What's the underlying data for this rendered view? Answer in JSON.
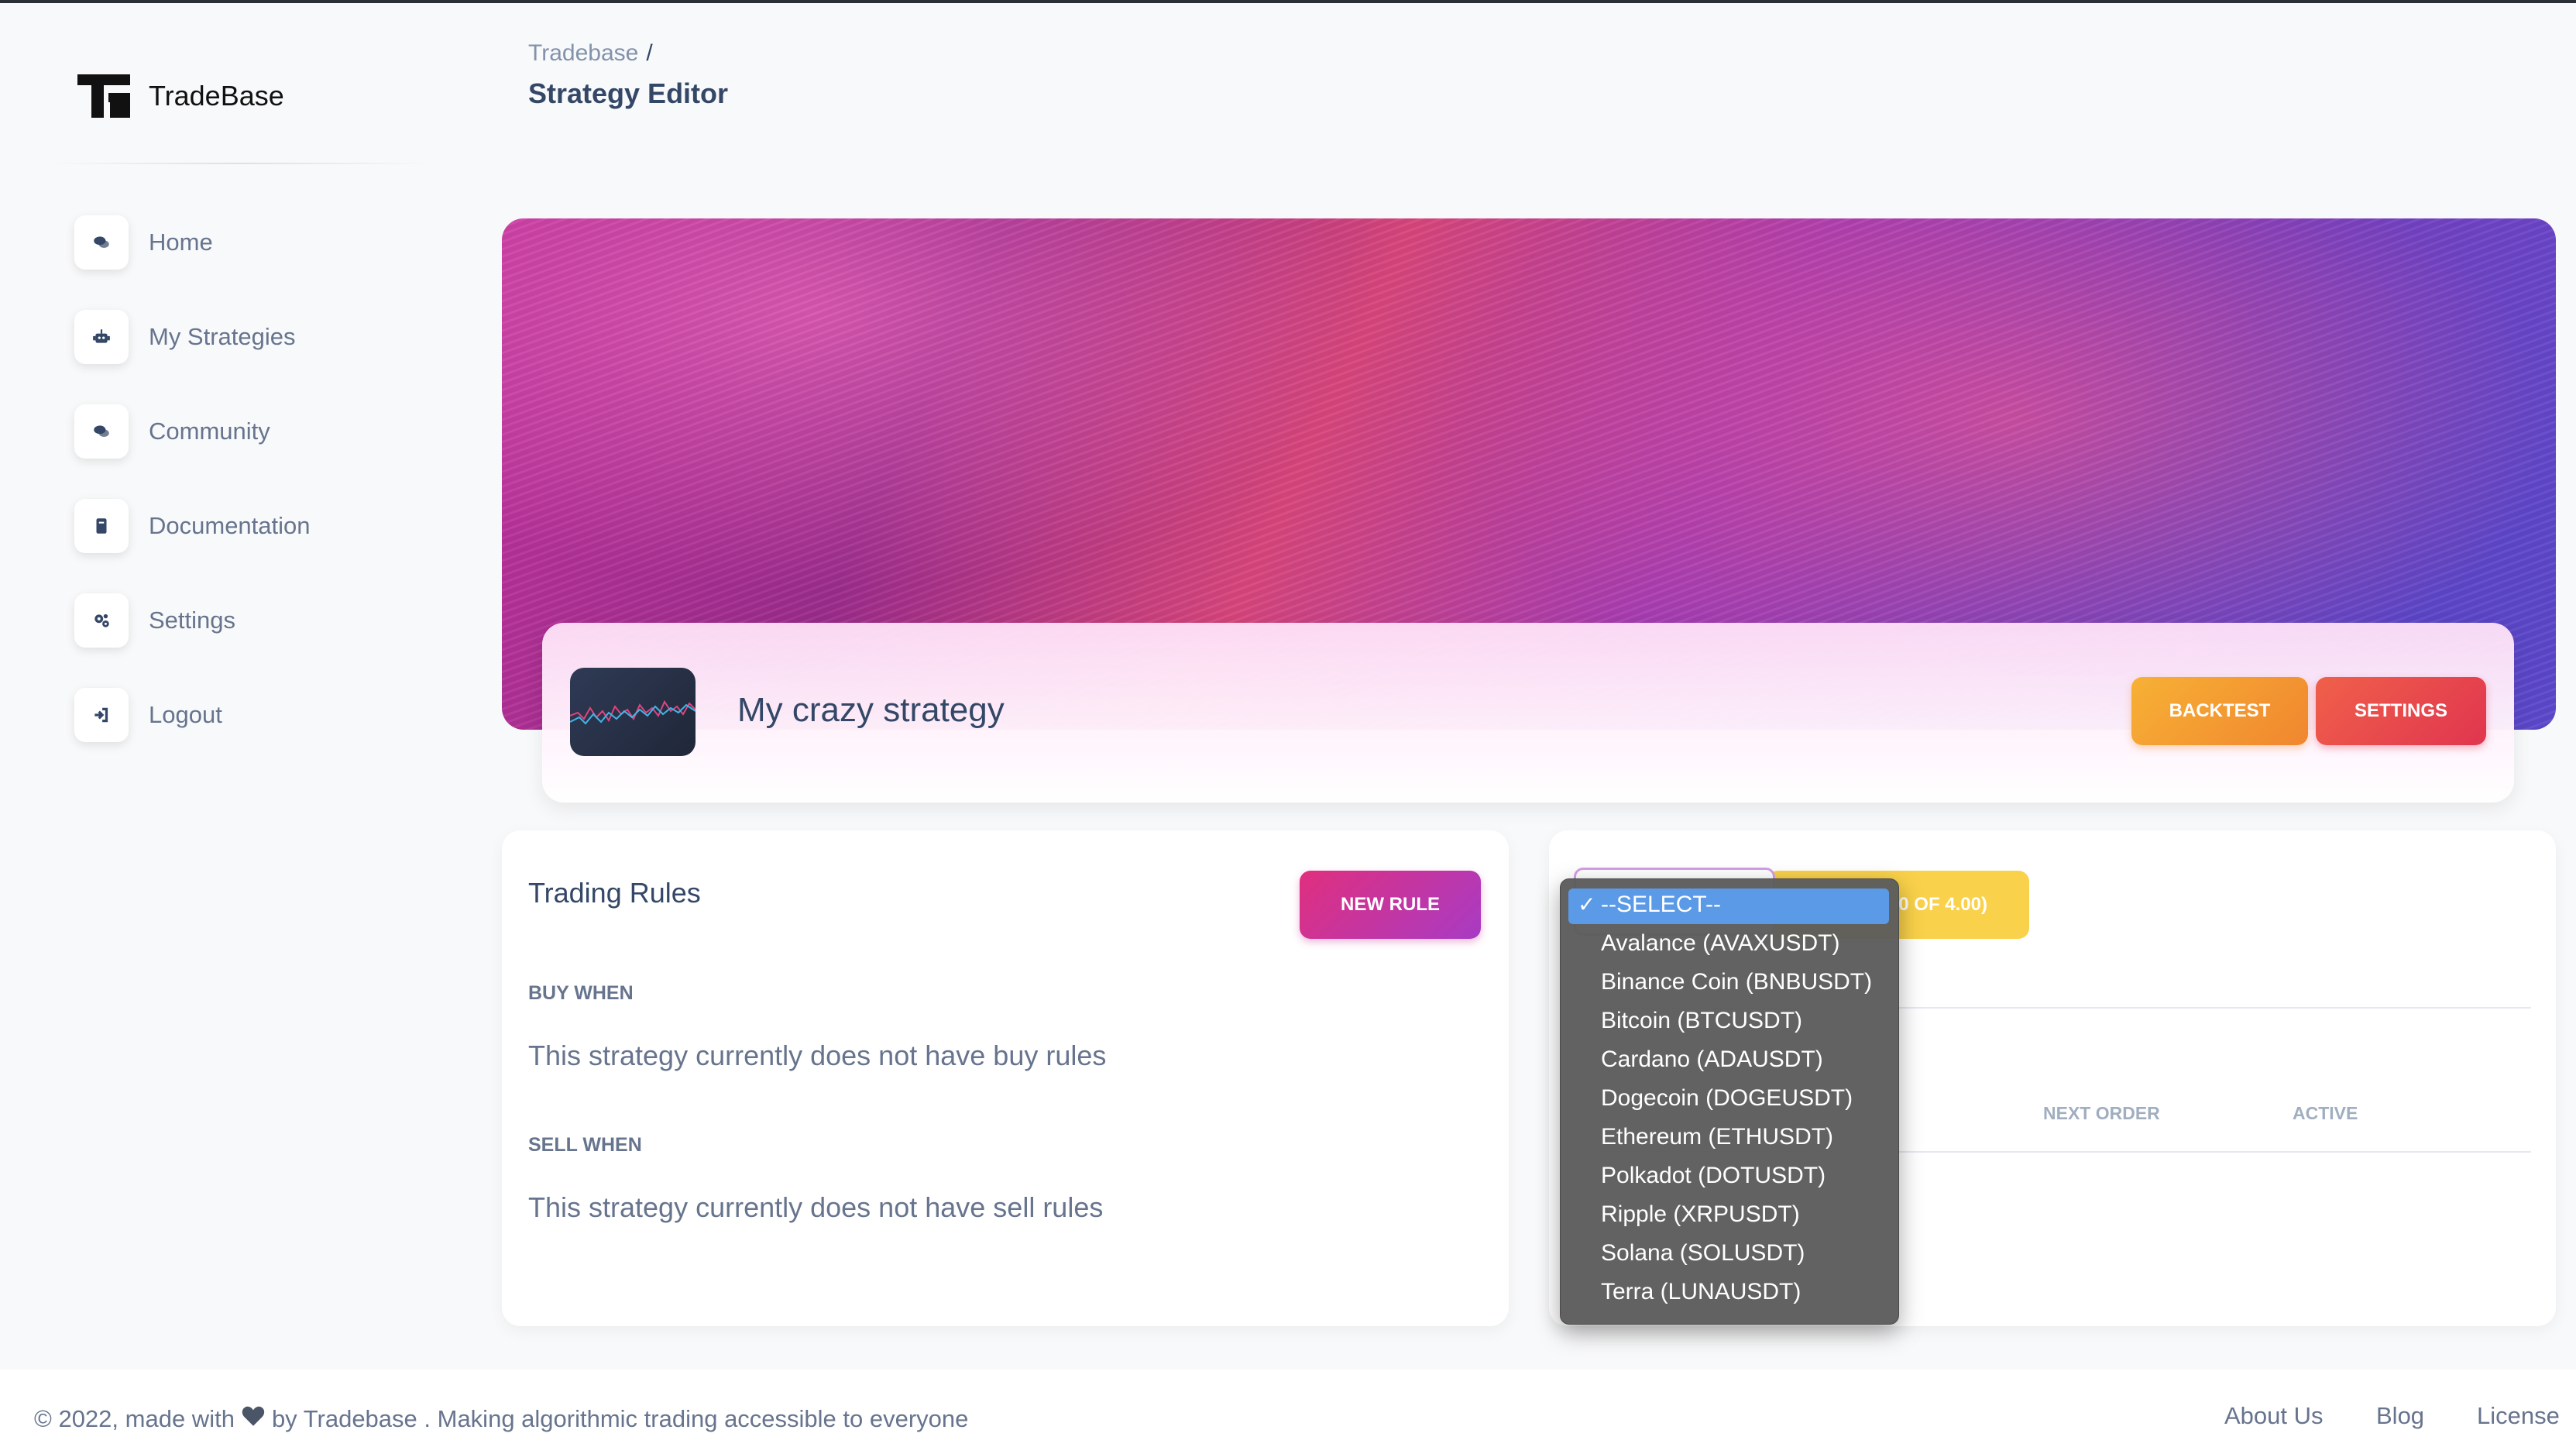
{
  "brand": {
    "name": "TradeBase"
  },
  "sidebar": {
    "items": [
      {
        "label": "Home",
        "icon": "chat-icon"
      },
      {
        "label": "My Strategies",
        "icon": "robot-icon"
      },
      {
        "label": "Community",
        "icon": "chat-icon"
      },
      {
        "label": "Documentation",
        "icon": "book-icon"
      },
      {
        "label": "Settings",
        "icon": "gears-icon"
      },
      {
        "label": "Logout",
        "icon": "logout-icon"
      }
    ]
  },
  "breadcrumb": {
    "root": "Tradebase",
    "separator": "/",
    "current": "Strategy Editor"
  },
  "strategy": {
    "name": "My crazy strategy",
    "backtest_label": "BACKTEST",
    "settings_label": "SETTINGS"
  },
  "rules": {
    "title": "Trading Rules",
    "new_rule_label": "NEW RULE",
    "buy_label": "BUY WHEN",
    "buy_empty": "This strategy currently does not have buy rules",
    "sell_label": "SELL WHEN",
    "sell_empty": "This strategy currently does not have sell rules"
  },
  "orders": {
    "button_partial": "0 OF 4.00)",
    "columns": [
      "NEXT ORDER",
      "ACTIVE"
    ]
  },
  "dropdown": {
    "selected": "--SELECT--",
    "check": "✓",
    "options": [
      "Avalance (AVAXUSDT)",
      "Binance Coin (BNBUSDT)",
      "Bitcoin (BTCUSDT)",
      "Cardano (ADAUSDT)",
      "Dogecoin (DOGEUSDT)",
      "Ethereum (ETHUSDT)",
      "Polkadot (DOTUSDT)",
      "Ripple (XRPUSDT)",
      "Solana (SOLUSDT)",
      "Terra (LUNAUSDT)"
    ]
  },
  "footer": {
    "prefix": "© 2022, made with",
    "suffix": "by Tradebase . Making algorithmic trading accessible to everyone",
    "links": [
      "About Us",
      "Blog",
      "License"
    ]
  },
  "colors": {
    "accent_pink": "#e02f7e",
    "backtest": "#f0862f",
    "settings": "#e0354f",
    "select_highlight": "#5b9ae6"
  }
}
